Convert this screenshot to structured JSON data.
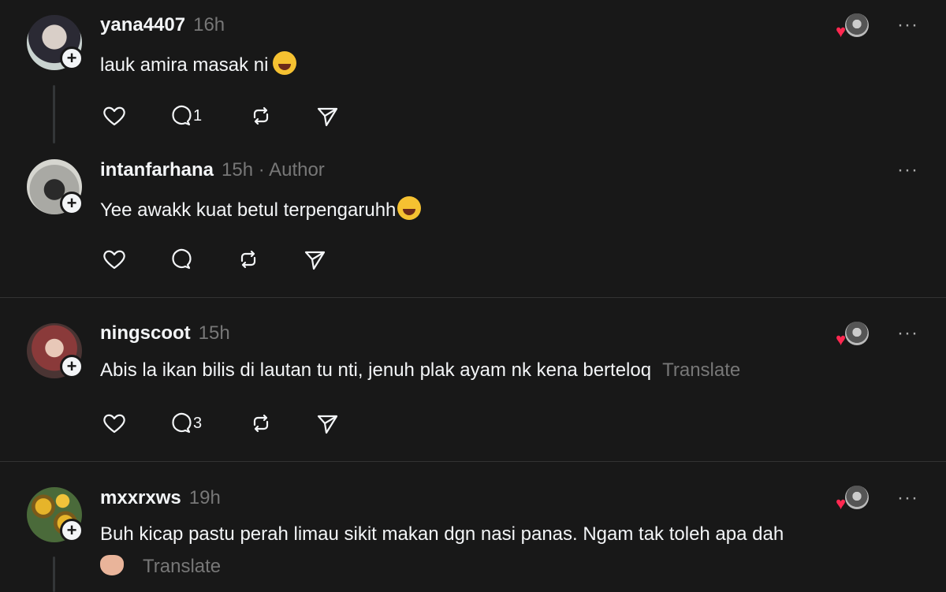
{
  "posts": [
    {
      "username": "yana4407",
      "time": "16h",
      "text": "lauk amira masak ni",
      "emoji": "rofl-emoji",
      "reply_count": "1",
      "more": "···"
    },
    {
      "username": "intanfarhana",
      "time": "15h",
      "author_tag": "· Author",
      "text": "Yee awakk kuat betul terpengaruhh",
      "emoji": "joy-emoji",
      "more": "···"
    },
    {
      "username": "ningscoot",
      "time": "15h",
      "text": "Abis la ikan bilis di lautan tu nti, jenuh plak ayam nk kena berteloq",
      "translate": "Translate",
      "reply_count": "3",
      "more": "···"
    },
    {
      "username": "mxxrxws",
      "time": "19h",
      "text": "Buh kicap pastu perah limau sikit makan dgn nasi panas. Ngam tak toleh apa dah",
      "translate": "Translate",
      "emoji": "handshake-emoji",
      "more": "···"
    }
  ],
  "follow_symbol": "+",
  "heart_symbol": "♥",
  "colors": {
    "background": "#181818",
    "text": "#f3f5f7",
    "muted": "#777777",
    "heart": "#ff2850"
  }
}
